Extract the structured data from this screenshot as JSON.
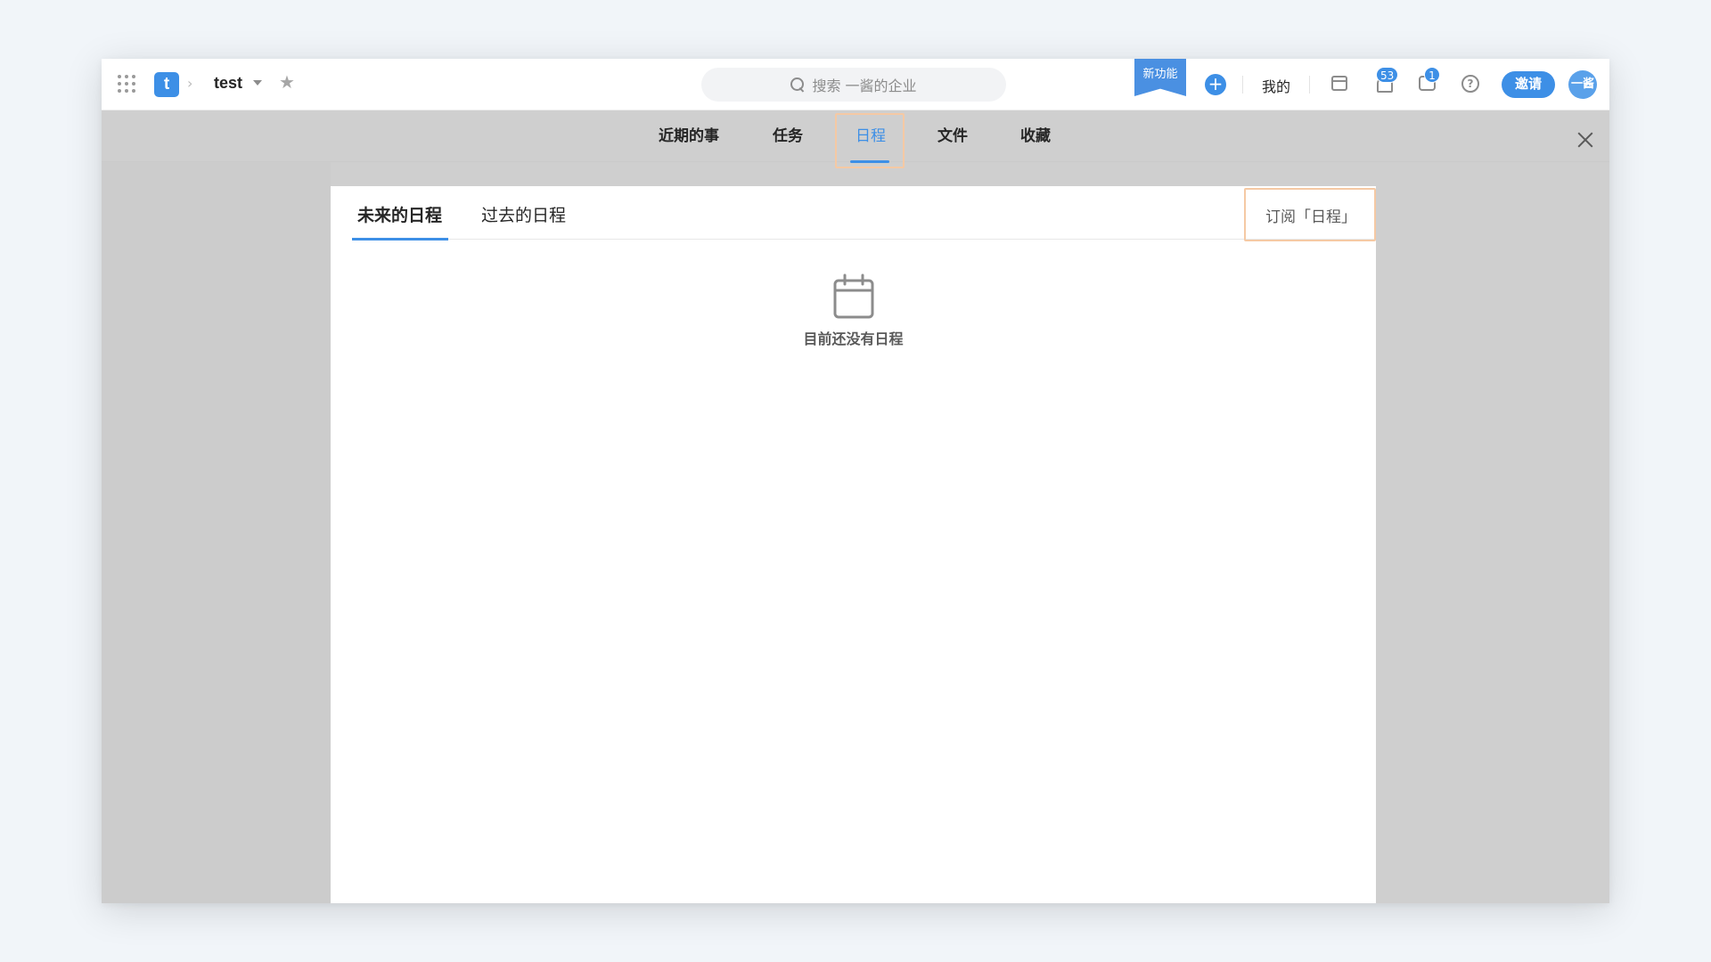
{
  "topbar": {
    "logo_letter": "t",
    "project_name": "test",
    "search_placeholder": "搜索 一酱的企业",
    "new_feature_label": "新功能",
    "mine_label": "我的",
    "notifications_count": "53",
    "messages_count": "1",
    "invite_label": "邀请",
    "avatar_text": "一酱"
  },
  "panel_nav": {
    "tabs": [
      "近期的事",
      "任务",
      "日程",
      "文件",
      "收藏"
    ],
    "active_tab": "日程"
  },
  "schedule": {
    "tabs": [
      "未来的日程",
      "过去的日程"
    ],
    "active_tab": "未来的日程",
    "subscribe_label": "订阅「日程」",
    "empty_text": "目前还没有日程"
  },
  "colors": {
    "accent": "#3d8fe6",
    "highlight_border": "#f5c9a4"
  }
}
